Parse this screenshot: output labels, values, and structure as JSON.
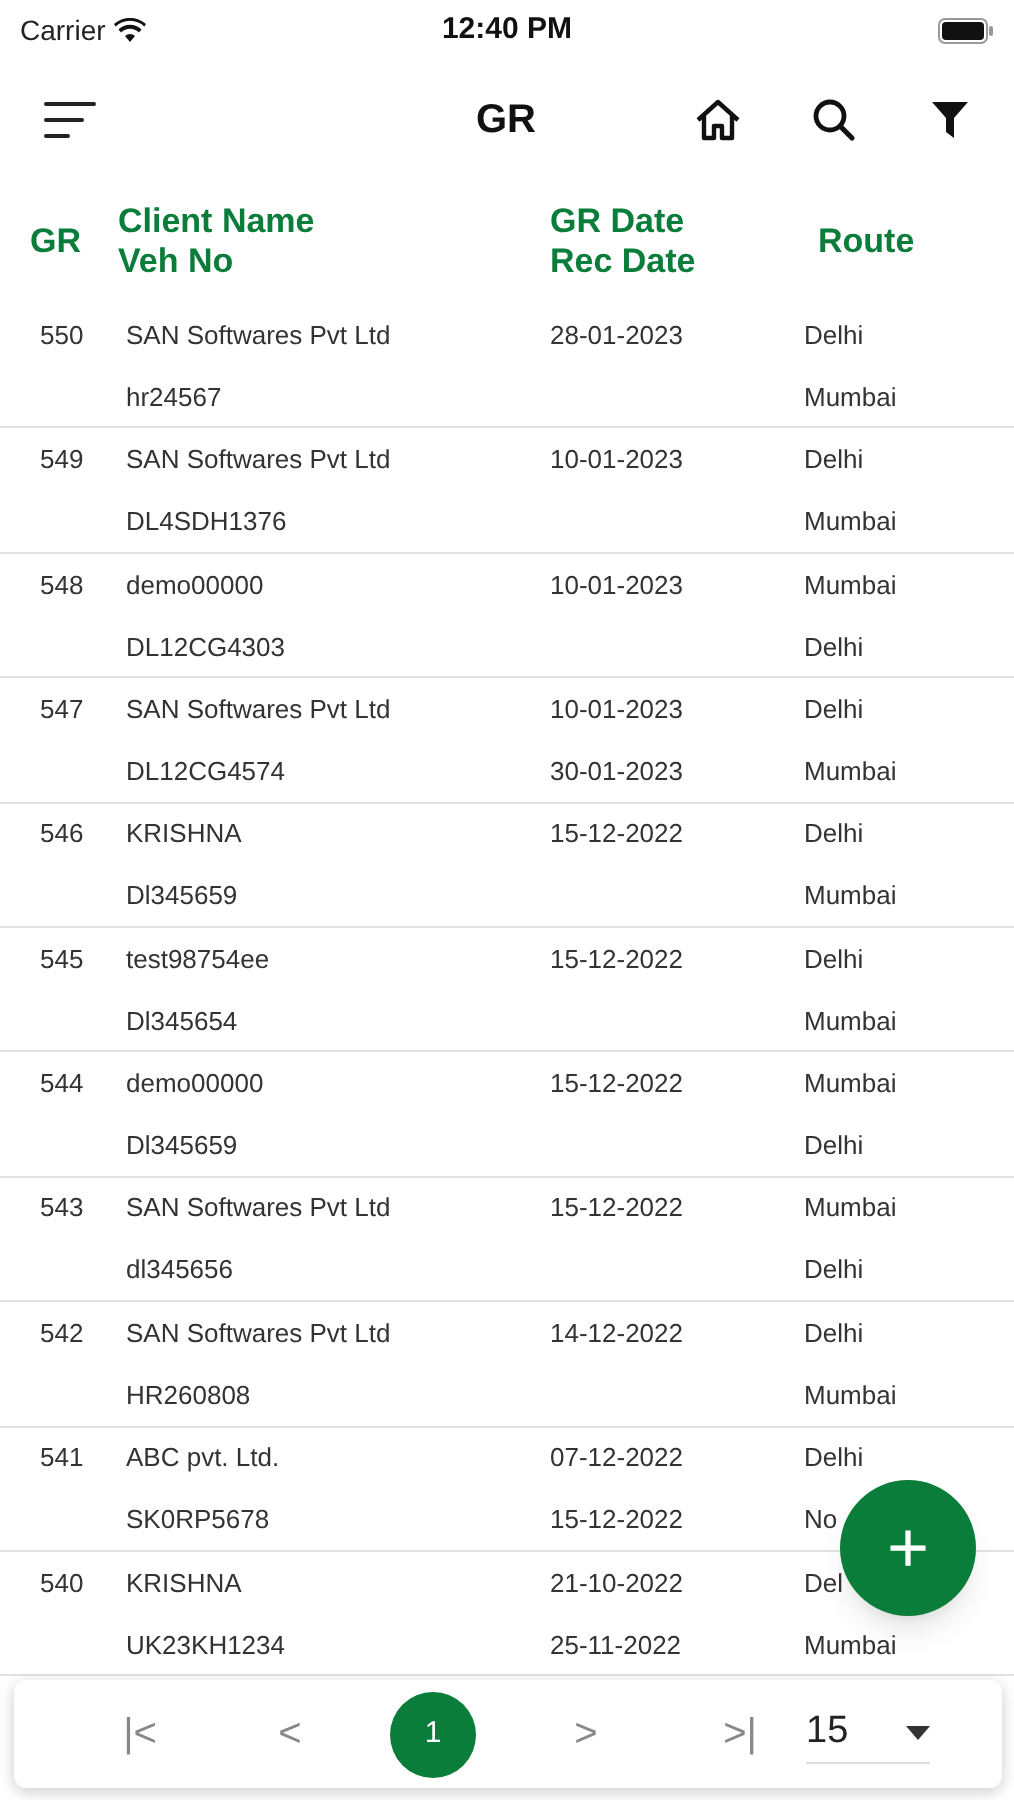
{
  "status_bar": {
    "carrier": "Carrier",
    "time": "12:40 PM"
  },
  "header": {
    "title": "GR"
  },
  "table": {
    "columns": [
      {
        "lines": [
          "GR"
        ]
      },
      {
        "lines": [
          "Client Name",
          "Veh No"
        ]
      },
      {
        "lines": [
          "GR Date",
          "Rec Date"
        ]
      },
      {
        "lines": [
          "Route"
        ]
      }
    ],
    "rows": [
      {
        "gr": "550",
        "client": "SAN Softwares Pvt Ltd",
        "veh": "hr24567",
        "gr_date": "28-01-2023",
        "route_from": "Delhi",
        "route_to": "Mumbai"
      },
      {
        "gr": "549",
        "client": "SAN Softwares Pvt Ltd",
        "veh": "DL4SDH1376",
        "gr_date": "10-01-2023",
        "route_from": "Delhi",
        "route_to": "Mumbai"
      },
      {
        "gr": "548",
        "client": "demo00000",
        "veh": "DL12CG4303",
        "gr_date": "10-01-2023",
        "route_from": "Mumbai",
        "route_to": "Delhi"
      },
      {
        "gr": "547",
        "client": "SAN Softwares Pvt Ltd",
        "veh": "DL12CG4574",
        "gr_date": "10-01-2023",
        "rec_date": "30-01-2023",
        "route_from": "Delhi",
        "route_to": "Mumbai"
      },
      {
        "gr": "546",
        "client": "KRISHNA",
        "veh": "Dl345659",
        "gr_date": "15-12-2022",
        "route_from": "Delhi",
        "route_to": "Mumbai"
      },
      {
        "gr": "545",
        "client": "test98754ee",
        "veh": "Dl345654",
        "gr_date": "15-12-2022",
        "route_from": "Delhi",
        "route_to": "Mumbai"
      },
      {
        "gr": "544",
        "client": "demo00000",
        "veh": "Dl345659",
        "gr_date": "15-12-2022",
        "route_from": "Mumbai",
        "route_to": "Delhi"
      },
      {
        "gr": "543",
        "client": "SAN Softwares Pvt Ltd",
        "veh": "dl345656",
        "gr_date": "15-12-2022",
        "route_from": "Mumbai",
        "route_to": "Delhi"
      },
      {
        "gr": "542",
        "client": "SAN Softwares Pvt Ltd",
        "veh": "HR260808",
        "gr_date": "14-12-2022",
        "route_from": "Delhi",
        "route_to": "Mumbai"
      },
      {
        "gr": "541",
        "client": "ABC pvt. Ltd.",
        "veh": "SK0RP5678",
        "gr_date": "07-12-2022",
        "rec_date": "15-12-2022",
        "route_from": "Delhi",
        "route_to": "No"
      },
      {
        "gr": "540",
        "client": "KRISHNA",
        "veh": "UK23KH1234",
        "gr_date": "21-10-2022",
        "rec_date": "25-11-2022",
        "route_from": "Del",
        "route_to": "Mumbai"
      }
    ]
  },
  "fab": {
    "label": "+"
  },
  "pagination": {
    "first": "|<",
    "prev": "<",
    "pages": [
      {
        "label": "1",
        "selected": true
      }
    ],
    "next": ">",
    "last": ">|",
    "page_size": "15"
  }
}
